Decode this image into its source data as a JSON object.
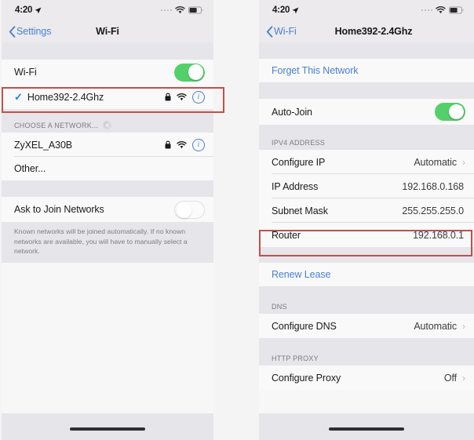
{
  "status_bar": {
    "time": "4:20",
    "location_icon": "location-arrow-icon",
    "signal_icon": "signal-dots-icon",
    "wifi_icon": "wifi-icon",
    "battery_icon": "battery-icon"
  },
  "left_phone": {
    "nav": {
      "back_label": "Settings",
      "back_icon": "chevron-left-icon",
      "title": "Wi-Fi"
    },
    "wifi_toggle": {
      "label": "Wi-Fi",
      "state": "on"
    },
    "connected_network": {
      "name": "Home392-2.4Ghz",
      "check_icon": "checkmark-icon",
      "lock_icon": "lock-icon",
      "wifi_icon": "wifi-icon",
      "info_icon": "info-circle-icon"
    },
    "choose_header": {
      "label": "CHOOSE A NETWORK...",
      "spinner_icon": "activity-spinner-icon"
    },
    "networks": [
      {
        "name": "ZyXEL_A30B",
        "lock_icon": "lock-icon",
        "wifi_icon": "wifi-icon",
        "info_icon": "info-circle-icon"
      }
    ],
    "other_row": {
      "label": "Other..."
    },
    "ask_to_join": {
      "label": "Ask to Join Networks",
      "state": "off"
    },
    "footer_note": "Known networks will be joined automatically. If no known networks are available, you will have to manually select a network."
  },
  "right_phone": {
    "nav": {
      "back_label": "Wi-Fi",
      "back_icon": "chevron-left-icon",
      "title": "Home392-2.4Ghz"
    },
    "forget_network": {
      "label": "Forget This Network"
    },
    "auto_join": {
      "label": "Auto-Join",
      "state": "on"
    },
    "ipv4": {
      "header": "IPV4 ADDRESS",
      "rows": [
        {
          "label": "Configure IP",
          "value": "Automatic",
          "chevron": "chevron-right-icon"
        },
        {
          "label": "IP Address",
          "value": "192.168.0.168",
          "chevron": ""
        },
        {
          "label": "Subnet Mask",
          "value": "255.255.255.0",
          "chevron": ""
        },
        {
          "label": "Router",
          "value": "192.168.0.1",
          "chevron": ""
        }
      ]
    },
    "renew_lease": {
      "label": "Renew Lease"
    },
    "dns": {
      "header": "DNS",
      "rows": [
        {
          "label": "Configure DNS",
          "value": "Automatic",
          "chevron": "chevron-right-icon"
        }
      ]
    },
    "http_proxy": {
      "header": "HTTP PROXY",
      "rows": [
        {
          "label": "Configure Proxy",
          "value": "Off",
          "chevron": "chevron-right-icon"
        }
      ]
    }
  },
  "annotations": {
    "highlight_color": "#c0504d",
    "boxes": [
      {
        "name": "connected-network-row"
      },
      {
        "name": "router-row"
      }
    ]
  },
  "colors": {
    "accent_blue": "#4a7fd4",
    "toggle_green": "#53d06a",
    "group_bg": "#f9f9f9",
    "gap_bg": "#e6e5e9"
  }
}
